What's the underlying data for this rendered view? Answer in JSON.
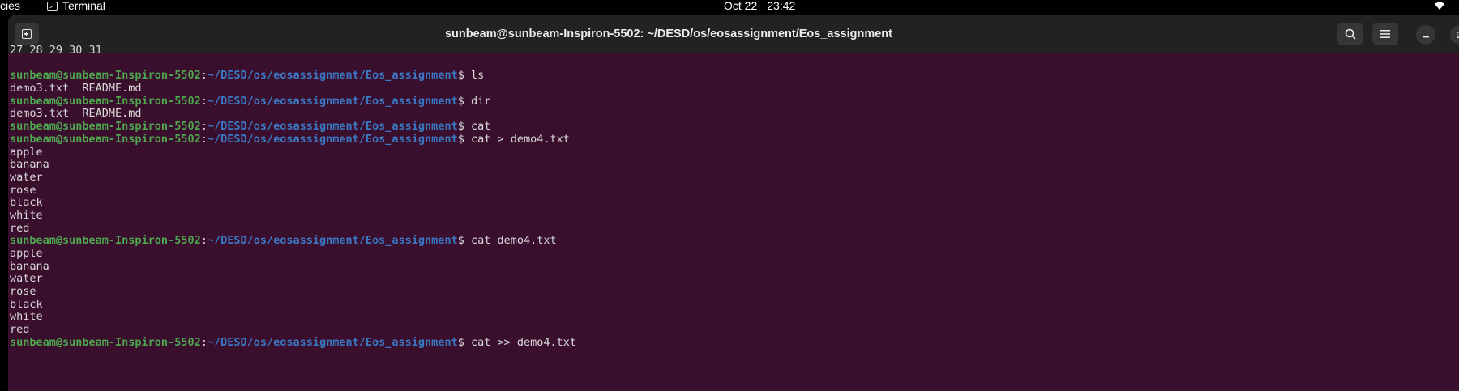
{
  "topbar": {
    "activities_label": "cies",
    "app_name": "Terminal",
    "date": "Oct 22",
    "time": "23:42"
  },
  "window": {
    "title": "sunbeam@sunbeam-Inspiron-5502: ~/DESD/os/eosassignment/Eos_assignment"
  },
  "colors": {
    "terminal_bg": "#3a0e2d",
    "prompt_user": "#4ea64e",
    "prompt_path": "#3b78c3",
    "headerbar": "#222222"
  },
  "terminal": {
    "user_host": "sunbeam@sunbeam-Inspiron-5502",
    "path": "~/DESD/os/eosassignment/Eos_assignment",
    "lines": [
      {
        "type": "out",
        "text": "27 28 29 30 31"
      },
      {
        "type": "out",
        "text": ""
      },
      {
        "type": "cmd",
        "cmd": "ls"
      },
      {
        "type": "out",
        "text": "demo3.txt  README.md"
      },
      {
        "type": "cmd",
        "cmd": "dir"
      },
      {
        "type": "out",
        "text": "demo3.txt  README.md"
      },
      {
        "type": "cmd",
        "cmd": "cat"
      },
      {
        "type": "cmd",
        "cmd": "cat > demo4.txt"
      },
      {
        "type": "out",
        "text": "apple"
      },
      {
        "type": "out",
        "text": "banana"
      },
      {
        "type": "out",
        "text": "water"
      },
      {
        "type": "out",
        "text": "rose"
      },
      {
        "type": "out",
        "text": "black"
      },
      {
        "type": "out",
        "text": "white"
      },
      {
        "type": "out",
        "text": "red"
      },
      {
        "type": "cmd",
        "cmd": "cat demo4.txt"
      },
      {
        "type": "out",
        "text": "apple"
      },
      {
        "type": "out",
        "text": "banana"
      },
      {
        "type": "out",
        "text": "water"
      },
      {
        "type": "out",
        "text": "rose"
      },
      {
        "type": "out",
        "text": "black"
      },
      {
        "type": "out",
        "text": "white"
      },
      {
        "type": "out",
        "text": "red"
      },
      {
        "type": "cmd",
        "cmd": "cat >> demo4.txt"
      }
    ]
  }
}
